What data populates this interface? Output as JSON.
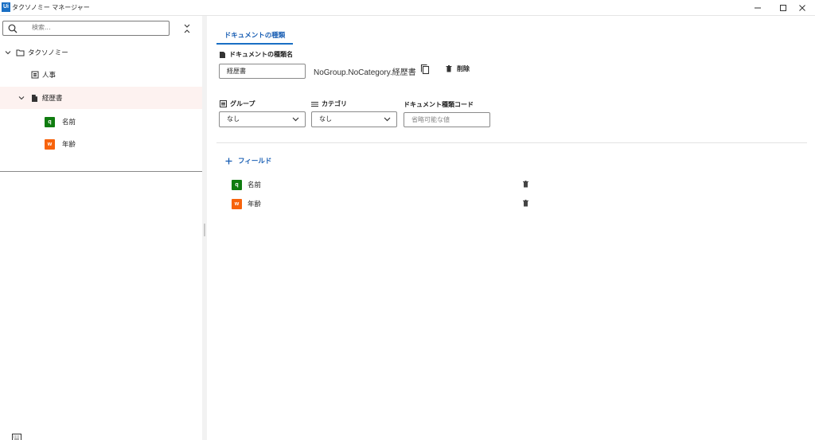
{
  "window": {
    "title": "タクソノミー マネージャー",
    "logo_text": "Ui",
    "controls": [
      "minimize-icon",
      "maximize-icon",
      "close-icon"
    ]
  },
  "sidebar": {
    "search_placeholder": "検索...",
    "tree": {
      "root": {
        "label": "タクソノミー",
        "icon": "folder-icon",
        "expanded": true
      },
      "items": [
        {
          "label": "人事",
          "icon": "group-icon"
        },
        {
          "label": "経歴書",
          "icon": "document-icon",
          "expanded": true,
          "selected": true,
          "fields": [
            {
              "badge": "q",
              "label": "名前",
              "badge_color": "#107c10"
            },
            {
              "badge": "w",
              "label": "年齢",
              "badge_color": "#f7630c"
            }
          ]
        }
      ]
    }
  },
  "main": {
    "tab_label": "ドキュメントの種類",
    "doc_type_name_label": "ドキュメントの種類名",
    "doc_type_name_value": "経歴書",
    "full_name": "NoGroup.NoCategory.経歴書",
    "delete_label": "削除",
    "group_label": "グループ",
    "group_value": "なし",
    "category_label": "カテゴリ",
    "category_value": "なし",
    "doc_code_label": "ドキュメント種類コード",
    "doc_code_placeholder": "省略可能な値",
    "add_field_label": "フィールド",
    "fields": [
      {
        "badge": "q",
        "label": "名前",
        "badge_color": "#107c10"
      },
      {
        "badge": "w",
        "label": "年齢",
        "badge_color": "#f7630c"
      }
    ]
  },
  "colors": {
    "accent": "#1a6fc4",
    "selected_row": "#fdf2f0"
  }
}
